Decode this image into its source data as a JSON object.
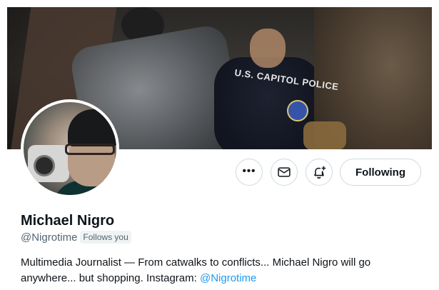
{
  "banner": {
    "text": "U.S. CAPITOL POLICE"
  },
  "actions": {
    "more_label": "•••",
    "follow_label": "Following"
  },
  "profile": {
    "name": "Michael Nigro",
    "handle": "@Nigrotime",
    "follows_you": "Follows you",
    "bio_text": "Multimedia Journalist — From catwalks to conflicts... Michael Nigro will go anywhere... but shopping. Instagram: ",
    "bio_link": "@Nigrotime"
  },
  "icons": {
    "more": "more-icon",
    "message": "envelope-icon",
    "notify": "bell-plus-icon"
  },
  "colors": {
    "link": "#1d9bf0",
    "secondary_text": "#536471",
    "border": "#cfd9de"
  }
}
